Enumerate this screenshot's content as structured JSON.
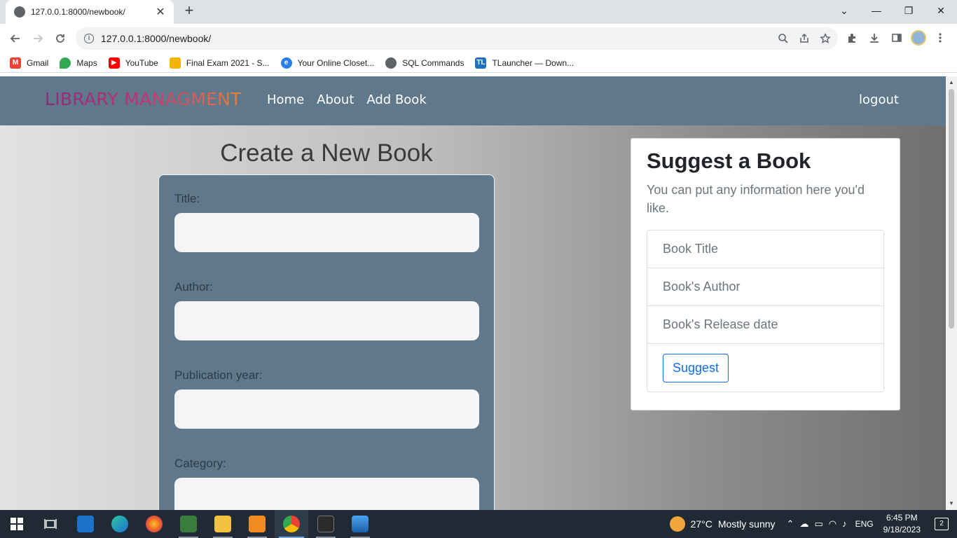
{
  "browser": {
    "tab_title": "127.0.0.1:8000/newbook/",
    "tab_close": "✕",
    "new_tab": "+",
    "url": "127.0.0.1:8000/newbook/",
    "window_controls": [
      "⌄",
      "—",
      "❐",
      "✕"
    ],
    "bookmarks": [
      {
        "label": "Gmail",
        "icon": "gmail-icon",
        "color": "#ea4335"
      },
      {
        "label": "Maps",
        "icon": "maps-icon",
        "color": "#34a853"
      },
      {
        "label": "YouTube",
        "icon": "youtube-icon",
        "color": "#ff0000"
      },
      {
        "label": "Final Exam 2021 - S...",
        "icon": "classroom-icon",
        "color": "#f4b400"
      },
      {
        "label": "Your Online Closet...",
        "icon": "closet-icon",
        "color": "#2b7de9"
      },
      {
        "label": "SQL Commands",
        "icon": "globe-icon",
        "color": "#5f6368"
      },
      {
        "label": "TLauncher — Down...",
        "icon": "tlauncher-icon",
        "color": "#1e73be"
      }
    ]
  },
  "site": {
    "brand": "LIBRARY MANAGMENT",
    "nav": {
      "home": "Home",
      "about": "About",
      "add_book": "Add Book"
    },
    "logout": "logout"
  },
  "form": {
    "title": "Create a New Book",
    "fields": {
      "title_label": "Title:",
      "author_label": "Author:",
      "year_label": "Publication year:",
      "category_label": "Category:"
    }
  },
  "suggest": {
    "title": "Suggest a Book",
    "text": "You can put any information here you'd like.",
    "items": [
      "Book Title",
      "Book's Author",
      "Book's Release date"
    ],
    "button": "Suggest"
  },
  "taskbar": {
    "weather_temp": "27°C",
    "weather_text": "Mostly sunny",
    "language": "ENG",
    "time": "6:45 PM",
    "date": "9/18/2023"
  },
  "colors": {
    "nav_bg": "#5f788b",
    "accent_blue": "#0d6efd"
  }
}
